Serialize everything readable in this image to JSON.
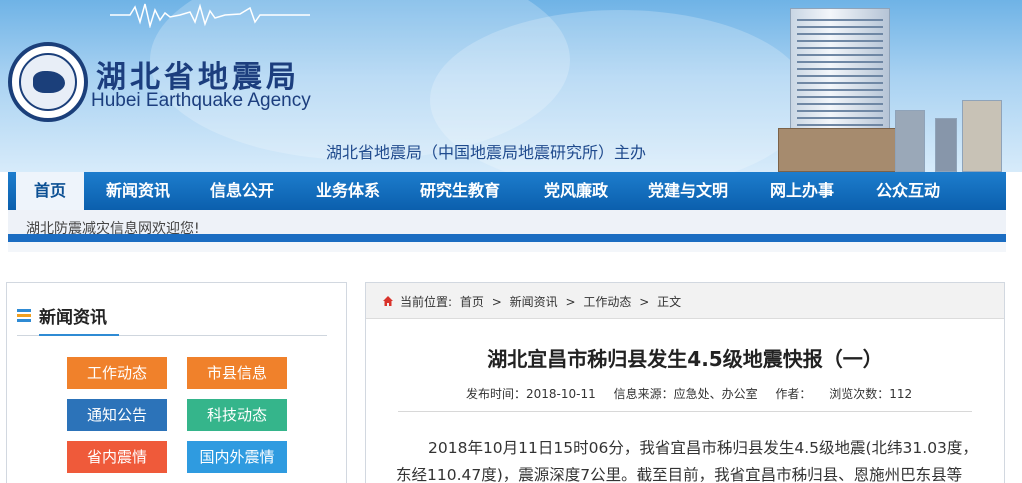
{
  "header": {
    "site_name_cn": "湖北省地震局",
    "site_name_en": "Hubei Earthquake Agency",
    "sponsor": "湖北省地震局（中国地震局地震研究所）主办",
    "logo_icon": "agency-seal-icon"
  },
  "nav": {
    "items": [
      {
        "label": "首页",
        "active": true
      },
      {
        "label": "新闻资讯",
        "active": false
      },
      {
        "label": "信息公开",
        "active": false
      },
      {
        "label": "业务体系",
        "active": false
      },
      {
        "label": "研究生教育",
        "active": false
      },
      {
        "label": "党风廉政",
        "active": false
      },
      {
        "label": "党建与文明",
        "active": false
      },
      {
        "label": "网上办事",
        "active": false
      },
      {
        "label": "公众互动",
        "active": false
      }
    ],
    "background": "#0b5fad"
  },
  "welcome": "湖北防震减灾信息网欢迎您!",
  "sidebar": {
    "title": "新闻资讯",
    "categories": [
      {
        "label": "工作动态",
        "color": "#f0812b"
      },
      {
        "label": "市县信息",
        "color": "#f0812b"
      },
      {
        "label": "通知公告",
        "color": "#2c73b9"
      },
      {
        "label": "科技动态",
        "color": "#35b58b"
      },
      {
        "label": "省内震情",
        "color": "#ef5a3a"
      },
      {
        "label": "国内外震情",
        "color": "#2f9be0"
      }
    ]
  },
  "article": {
    "breadcrumb": {
      "prefix": "当前位置:",
      "items": [
        "首页",
        "新闻资讯",
        "工作动态",
        "正文"
      ],
      "separator": ">"
    },
    "title": "湖北宜昌市秭归县发生4.5级地震快报（一）",
    "meta": {
      "publish_time": "发布时间：2018-10-11",
      "source": "信息来源：应急处、办公室",
      "author": "作者：",
      "views": "浏览次数：112"
    },
    "body": "2018年10月11日15时06分，我省宜昌市秭归县发生4.5级地震(北纬31.03度，东经110.47度)，震源深度7公里。截至目前，我省宜昌市秭归县、恩施州巴东县等"
  }
}
